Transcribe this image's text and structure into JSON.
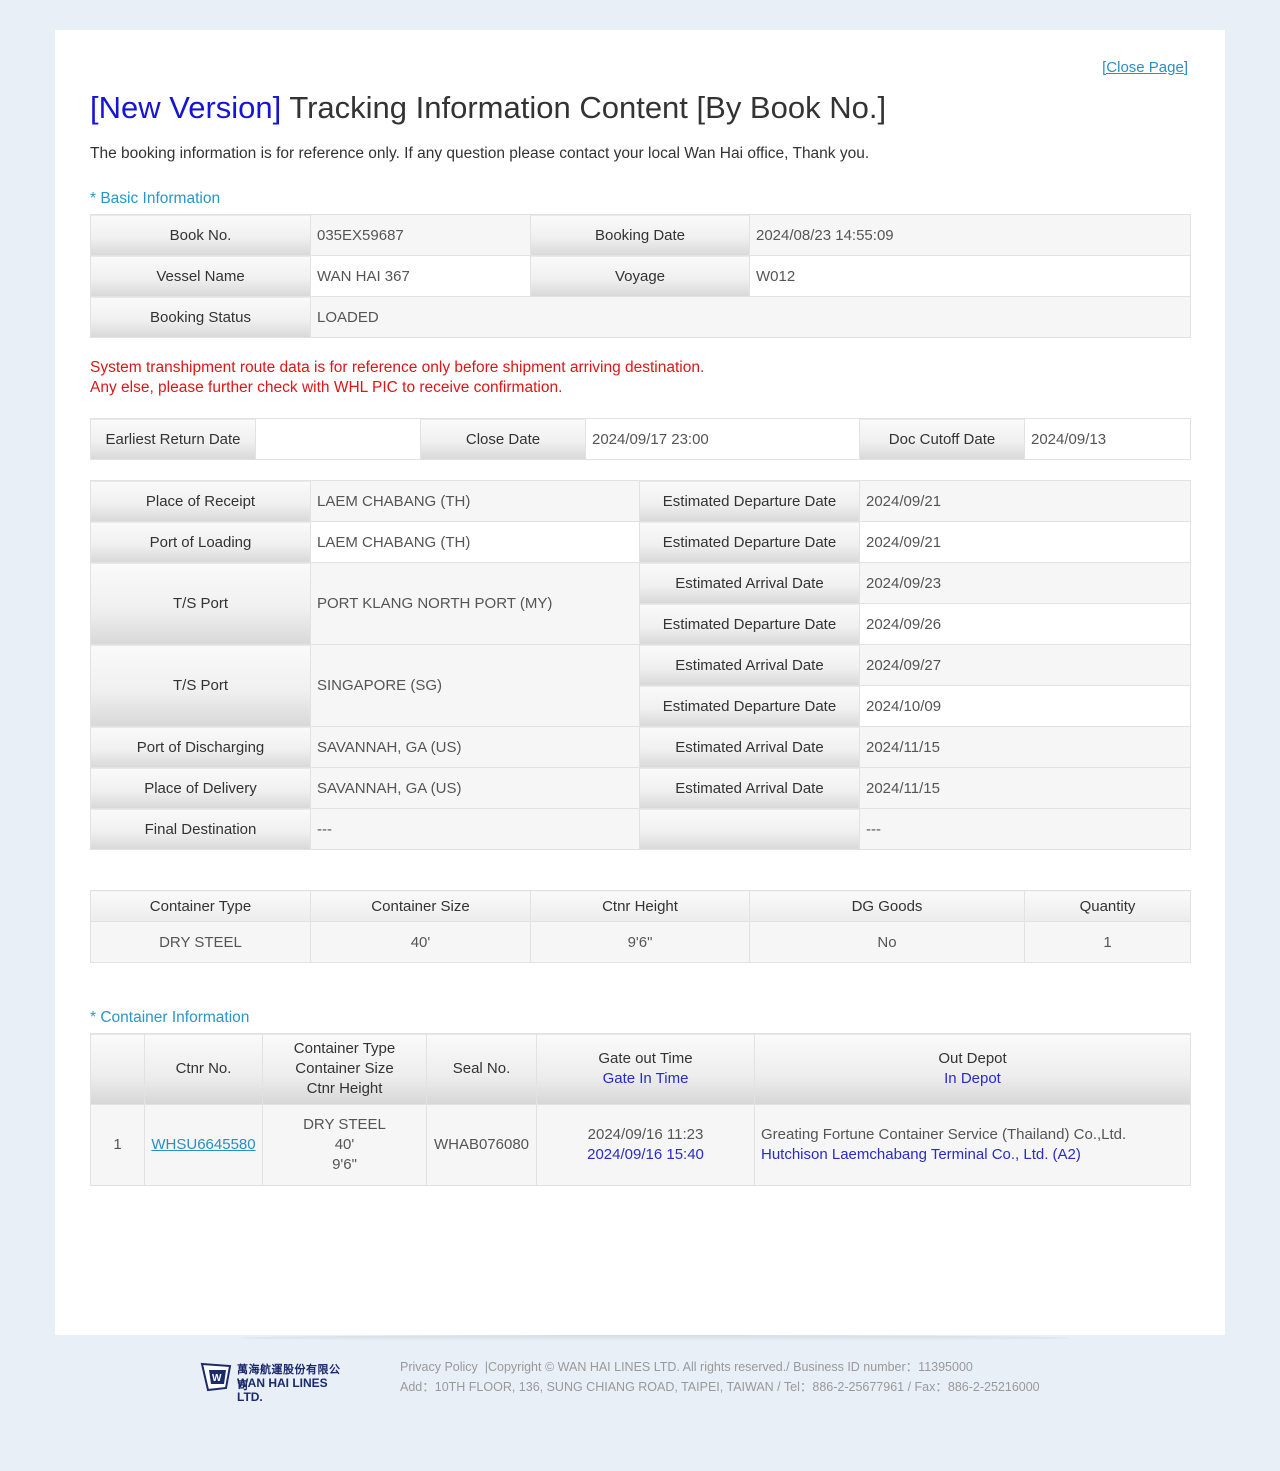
{
  "header": {
    "close_link": "[Close Page]",
    "title_prefix": "[New Version]",
    "title_main": " Tracking Information Content [By Book No.]",
    "subtitle": "The booking information is for reference only. If any question please contact your local Wan Hai office, Thank you."
  },
  "basic": {
    "section_label": "* Basic Information",
    "book_no_label": "Book No.",
    "book_no": "035EX59687",
    "booking_date_label": "Booking Date",
    "booking_date": "2024/08/23 14:55:09",
    "vessel_label": "Vessel Name",
    "vessel": "WAN HAI 367",
    "voyage_label": "Voyage",
    "voyage": "W012",
    "status_label": "Booking Status",
    "status": "LOADED"
  },
  "notice": {
    "line1": "System transhipment route data is for reference only before shipment arriving destination.",
    "line2": "Any else, please further check with WHL PIC to receive confirmation."
  },
  "dates": {
    "earliest_return_label": "Earliest Return Date",
    "earliest_return": "",
    "close_date_label": "Close Date",
    "close_date": "2024/09/17 23:00",
    "doc_cutoff_label": "Doc Cutoff Date",
    "doc_cutoff": "2024/09/13"
  },
  "route": {
    "receipt_label": "Place of Receipt",
    "receipt": "LAEM CHABANG (TH)",
    "receipt_event": "Estimated Departure Date",
    "receipt_date": "2024/09/21",
    "loading_label": "Port of Loading",
    "loading": "LAEM CHABANG (TH)",
    "loading_event": "Estimated Departure Date",
    "loading_date": "2024/09/21",
    "ts1_label": "T/S Port",
    "ts1": "PORT KLANG NORTH PORT (MY)",
    "ts1_arr_event": "Estimated Arrival Date",
    "ts1_arr": "2024/09/23",
    "ts1_dep_event": "Estimated Departure Date",
    "ts1_dep": "2024/09/26",
    "ts2_label": "T/S Port",
    "ts2": "SINGAPORE (SG)",
    "ts2_arr_event": "Estimated Arrival Date",
    "ts2_arr": "2024/09/27",
    "ts2_dep_event": "Estimated Departure Date",
    "ts2_dep": "2024/10/09",
    "discharging_label": "Port of Discharging",
    "discharging": "SAVANNAH, GA (US)",
    "discharging_event": "Estimated Arrival Date",
    "discharging_date": "2024/11/15",
    "delivery_label": "Place of Delivery",
    "delivery": "SAVANNAH, GA (US)",
    "delivery_event": "Estimated Arrival Date",
    "delivery_date": "2024/11/15",
    "final_label": "Final Destination",
    "final": "---",
    "final_event": "",
    "final_date": "---"
  },
  "container_types": {
    "headers": [
      "Container Type",
      "Container Size",
      "Ctnr Height",
      "DG Goods",
      "Quantity"
    ],
    "row": [
      "DRY STEEL",
      "40'",
      "9'6\"",
      "No",
      "1"
    ]
  },
  "container_info": {
    "section_label": "* Container Information",
    "h_no": "",
    "h_ctnr": "Ctnr No.",
    "h_type1": "Container Type",
    "h_type2": "Container Size",
    "h_type3": "Ctnr Height",
    "h_seal": "Seal No.",
    "h_gate1": "Gate out Time",
    "h_gate2": "Gate In Time",
    "h_depot1": "Out Depot",
    "h_depot2": "In Depot",
    "row": {
      "idx": "1",
      "ctnr": "WHSU6645580",
      "type": "DRY STEEL",
      "size": "40'",
      "height": "9'6\"",
      "seal": "WHAB076080",
      "gate_out": "2024/09/16 11:23",
      "gate_in": "2024/09/16 15:40",
      "out_depot": "Greating Fortune Container Service (Thailand) Co.,Ltd.",
      "in_depot": "Hutchison Laemchabang Terminal Co., Ltd. (A2)"
    }
  },
  "footer": {
    "logo_cn": "萬海航運股份有限公司",
    "logo_en": "WAN HAI LINES LTD.",
    "privacy": "Privacy Policy",
    "copyright": "  |Copyright © WAN HAI LINES LTD. All rights reserved./ Business ID number：11395000",
    "address": "Add：10TH FLOOR, 136, SUNG CHIANG ROAD, TAIPEI, TAIWAN / Tel：886-2-25677961 / Fax：886-2-25216000"
  },
  "colors": {
    "accent_blue": "#1515d6",
    "link_blue": "#2a8fc5",
    "section_blue": "#2a96c8",
    "notice_red": "#e01515",
    "page_bg": "#e9eff7"
  }
}
